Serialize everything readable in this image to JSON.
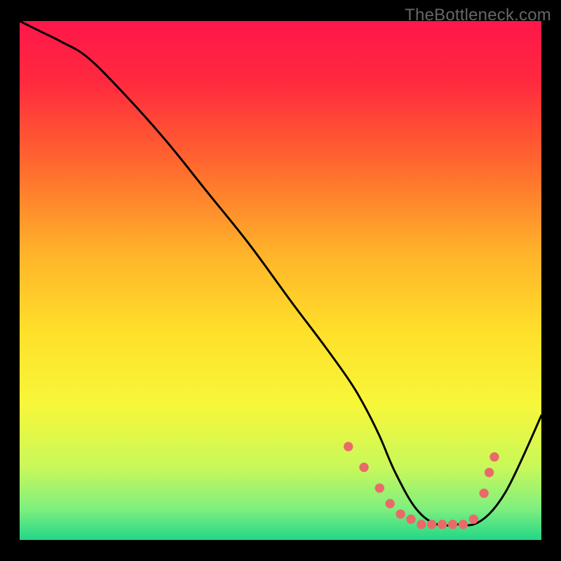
{
  "watermark": "TheBottleneck.com",
  "chart_data": {
    "type": "line",
    "title": "",
    "xlabel": "",
    "ylabel": "",
    "xlim": [
      0,
      100
    ],
    "ylim": [
      0,
      100
    ],
    "background_gradient": [
      {
        "pos": 0.0,
        "color": "#ff164a"
      },
      {
        "pos": 0.12,
        "color": "#ff2a3e"
      },
      {
        "pos": 0.28,
        "color": "#ff6a2e"
      },
      {
        "pos": 0.45,
        "color": "#ffb42a"
      },
      {
        "pos": 0.6,
        "color": "#ffe02a"
      },
      {
        "pos": 0.74,
        "color": "#f7f73a"
      },
      {
        "pos": 0.86,
        "color": "#c8f85a"
      },
      {
        "pos": 0.94,
        "color": "#7fef7f"
      },
      {
        "pos": 1.0,
        "color": "#23d688"
      }
    ],
    "series": [
      {
        "name": "bottleneck-curve",
        "x": [
          0,
          4,
          8,
          13,
          20,
          28,
          36,
          44,
          52,
          58,
          63,
          66,
          69,
          72,
          76,
          80,
          84,
          87,
          90,
          93,
          96,
          100
        ],
        "y": [
          100,
          98,
          96,
          93,
          86,
          77,
          67,
          57,
          46,
          38,
          31,
          26,
          20,
          13,
          6,
          3,
          3,
          3,
          5,
          9,
          15,
          24
        ]
      }
    ],
    "markers": {
      "name": "highlight-points",
      "color": "#ea6a6a",
      "points": [
        {
          "x": 63,
          "y": 18
        },
        {
          "x": 66,
          "y": 14
        },
        {
          "x": 69,
          "y": 10
        },
        {
          "x": 71,
          "y": 7
        },
        {
          "x": 73,
          "y": 5
        },
        {
          "x": 75,
          "y": 4
        },
        {
          "x": 77,
          "y": 3
        },
        {
          "x": 79,
          "y": 3
        },
        {
          "x": 81,
          "y": 3
        },
        {
          "x": 83,
          "y": 3
        },
        {
          "x": 85,
          "y": 3
        },
        {
          "x": 87,
          "y": 4
        },
        {
          "x": 89,
          "y": 9
        },
        {
          "x": 90,
          "y": 13
        },
        {
          "x": 91,
          "y": 16
        }
      ]
    }
  }
}
